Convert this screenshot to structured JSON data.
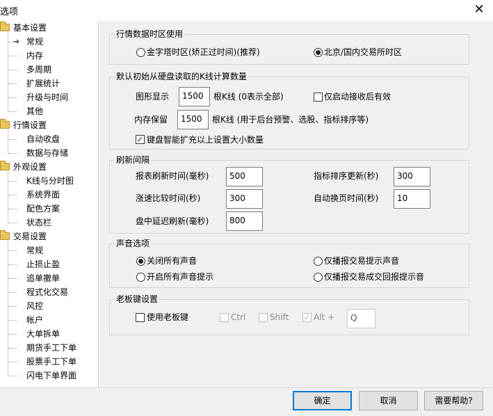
{
  "window": {
    "title": "选项"
  },
  "tree": {
    "groups": [
      {
        "label": "基本设置",
        "children": [
          "常规",
          "内存",
          "多周期",
          "扩展统计",
          "升级与时间",
          "其他"
        ]
      },
      {
        "label": "行情设置",
        "children": [
          "自动收盘",
          "数据与存储"
        ]
      },
      {
        "label": "外观设置",
        "children": [
          "K线与分时图",
          "系统界面",
          "配色方案",
          "状态栏"
        ]
      },
      {
        "label": "交易设置",
        "children": [
          "常规",
          "止损止盈",
          "追单撤单",
          "程式化交易",
          "风控",
          "帐户",
          "大单拆单",
          "期货手工下单",
          "股票手工下单",
          "闪电下单界面"
        ]
      }
    ],
    "selected": "基本设置/常规"
  },
  "timezone": {
    "title": "行情数据时区使用",
    "option1": "金字塔时区(矫正过时间)(推荐)",
    "option2": "北京/国内交易所时区",
    "selected": "option2"
  },
  "kline": {
    "title": "默认初始从硬盘读取的K线计算数量",
    "display_label": "图形显示",
    "display_value": "1500",
    "display_unit": "根K线 (0表示全部)",
    "only_after_receive": "仅启动接收后有效",
    "only_after_receive_checked": false,
    "memory_label": "内存保留",
    "memory_value": "1500",
    "memory_unit": "根K线 (用于后台预警、选股、指标排序等)",
    "smart_expand": "键盘智能扩充以上设置大小数量",
    "smart_expand_checked": true
  },
  "refresh": {
    "title": "刷新间隔",
    "report_label": "报表刷新时间(毫秒)",
    "report_value": "500",
    "indicator_label": "指标排序更新(秒)",
    "indicator_value": "300",
    "speed_label": "涨速比较时间(秒)",
    "speed_value": "300",
    "autopage_label": "自动换页时间(秒)",
    "autopage_value": "10",
    "delay_label": "盘中延迟刷新(毫秒)",
    "delay_value": "800"
  },
  "sound": {
    "title": "声音选项",
    "off_all": "关闭所有声音",
    "on_all": "开启所有声音提示",
    "trade_only": "仅播报交易提示声音",
    "trade_result_only": "仅播报交易成交回报提示音",
    "selected": "off_all"
  },
  "bosskey": {
    "title": "老板键设置",
    "use_label": "使用老板键",
    "use_checked": false,
    "ctrl": "Ctrl",
    "shift": "Shift",
    "alt": "Alt +",
    "alt_checked": true,
    "key": "Q"
  },
  "buttons": {
    "ok": "确定",
    "cancel": "取消",
    "help": "需要帮助?"
  }
}
